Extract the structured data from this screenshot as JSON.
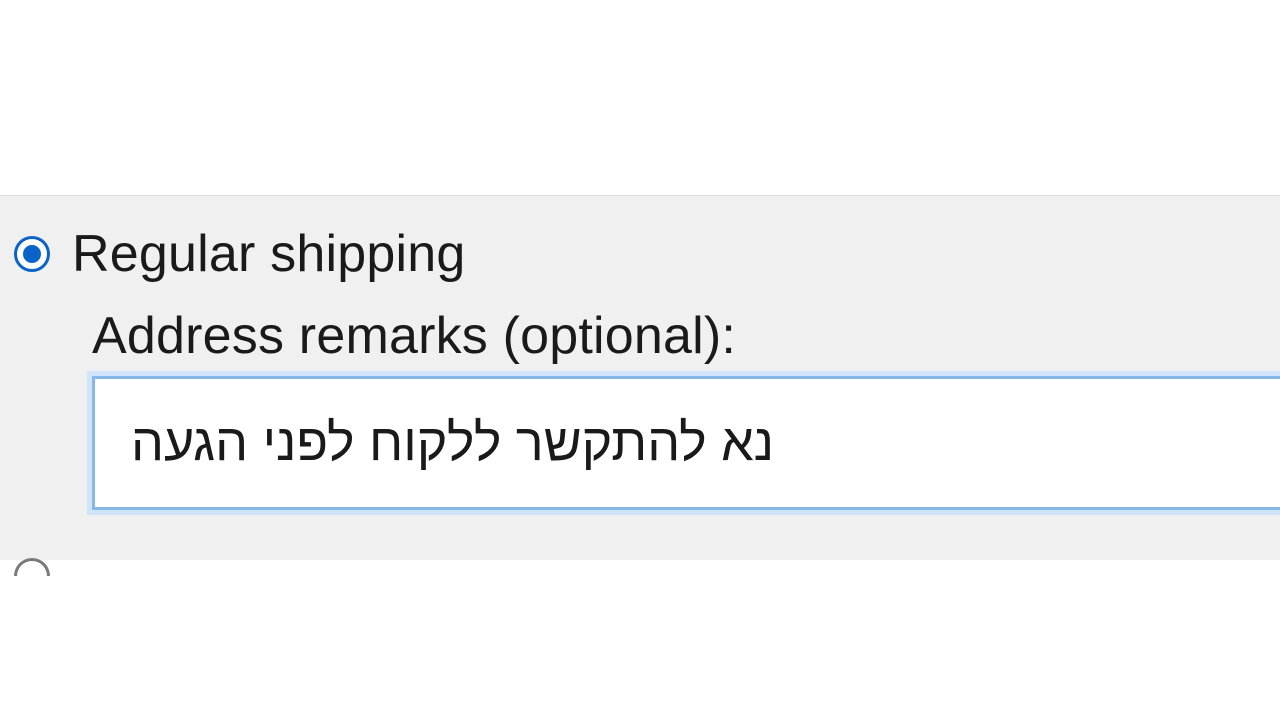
{
  "shipping": {
    "option_regular_label": "Regular shipping",
    "address_remarks_label": "Address remarks (optional):",
    "address_remarks_value": "נא להתקשר ללקוח לפני הגעה"
  }
}
